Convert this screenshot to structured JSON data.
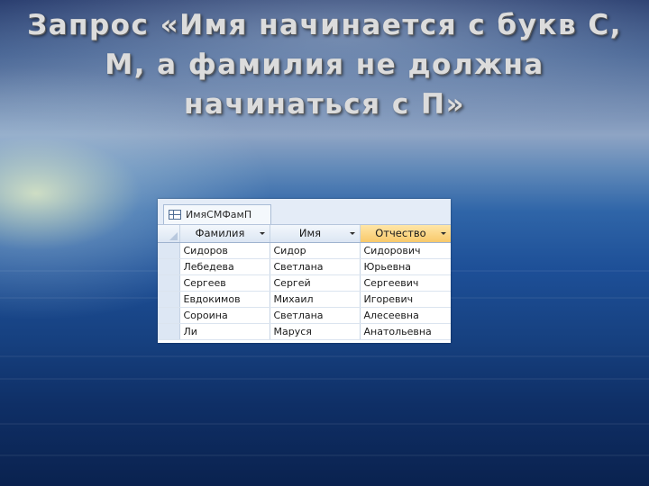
{
  "slide": {
    "title_lines": [
      "Запрос «Имя начинается с букв С,",
      "М, а фамилия не должна",
      "начинаться с П»"
    ]
  },
  "query_window": {
    "tab_label": "ИмяСМФамП",
    "columns": [
      "Фамилия",
      "Имя",
      "Отчество"
    ],
    "selected_column": "Отчество",
    "rows": [
      [
        "Сидоров",
        "Сидор",
        "Сидорович"
      ],
      [
        "Лебедева",
        "Светлана",
        "Юрьевна"
      ],
      [
        "Сергеев",
        "Сергей",
        "Сергеевич"
      ],
      [
        "Евдокимов",
        "Михаил",
        "Игоревич"
      ],
      [
        "Сорoина",
        "Светлана",
        "Алесеевна"
      ],
      [
        "Ли",
        "Маруся",
        "Анатольевна"
      ]
    ],
    "icons": {
      "tab": "datasheet-icon",
      "column_dropdown": "dropdown-arrow-icon",
      "select_all": "select-all-corner-icon"
    },
    "colors": {
      "selected_header": "#f8c96a",
      "header": "#dce6f3",
      "tab_bar": "#e4ecf7"
    }
  }
}
